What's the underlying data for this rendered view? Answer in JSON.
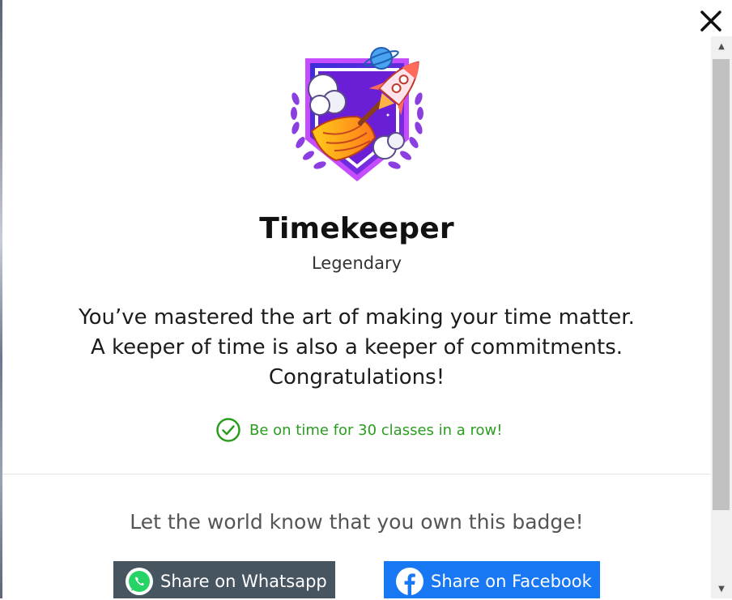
{
  "badge": {
    "title": "Timekeeper",
    "rarity": "Legendary",
    "description_lines": [
      "You’ve mastered the art of making your time matter.",
      "A keeper of time is also a keeper of commitments.",
      "Congratulations!"
    ],
    "requirement": "Be on time for 30 classes in a row!",
    "requirement_status": "completed",
    "icon": "timekeeper-badge-icon"
  },
  "share": {
    "prompt": "Let the world know that you own this badge!",
    "whatsapp_label": "Share on Whatsapp",
    "facebook_label": "Share on Facebook"
  },
  "icons": {
    "close": "close-icon",
    "requirement": "checkmark-circle-icon",
    "whatsapp": "whatsapp-icon",
    "facebook": "facebook-icon"
  },
  "colors": {
    "success": "#2a9d1f",
    "whatsapp_button": "#475561",
    "facebook_button": "#1877f2",
    "badge_purple": "#7b2ff7"
  }
}
